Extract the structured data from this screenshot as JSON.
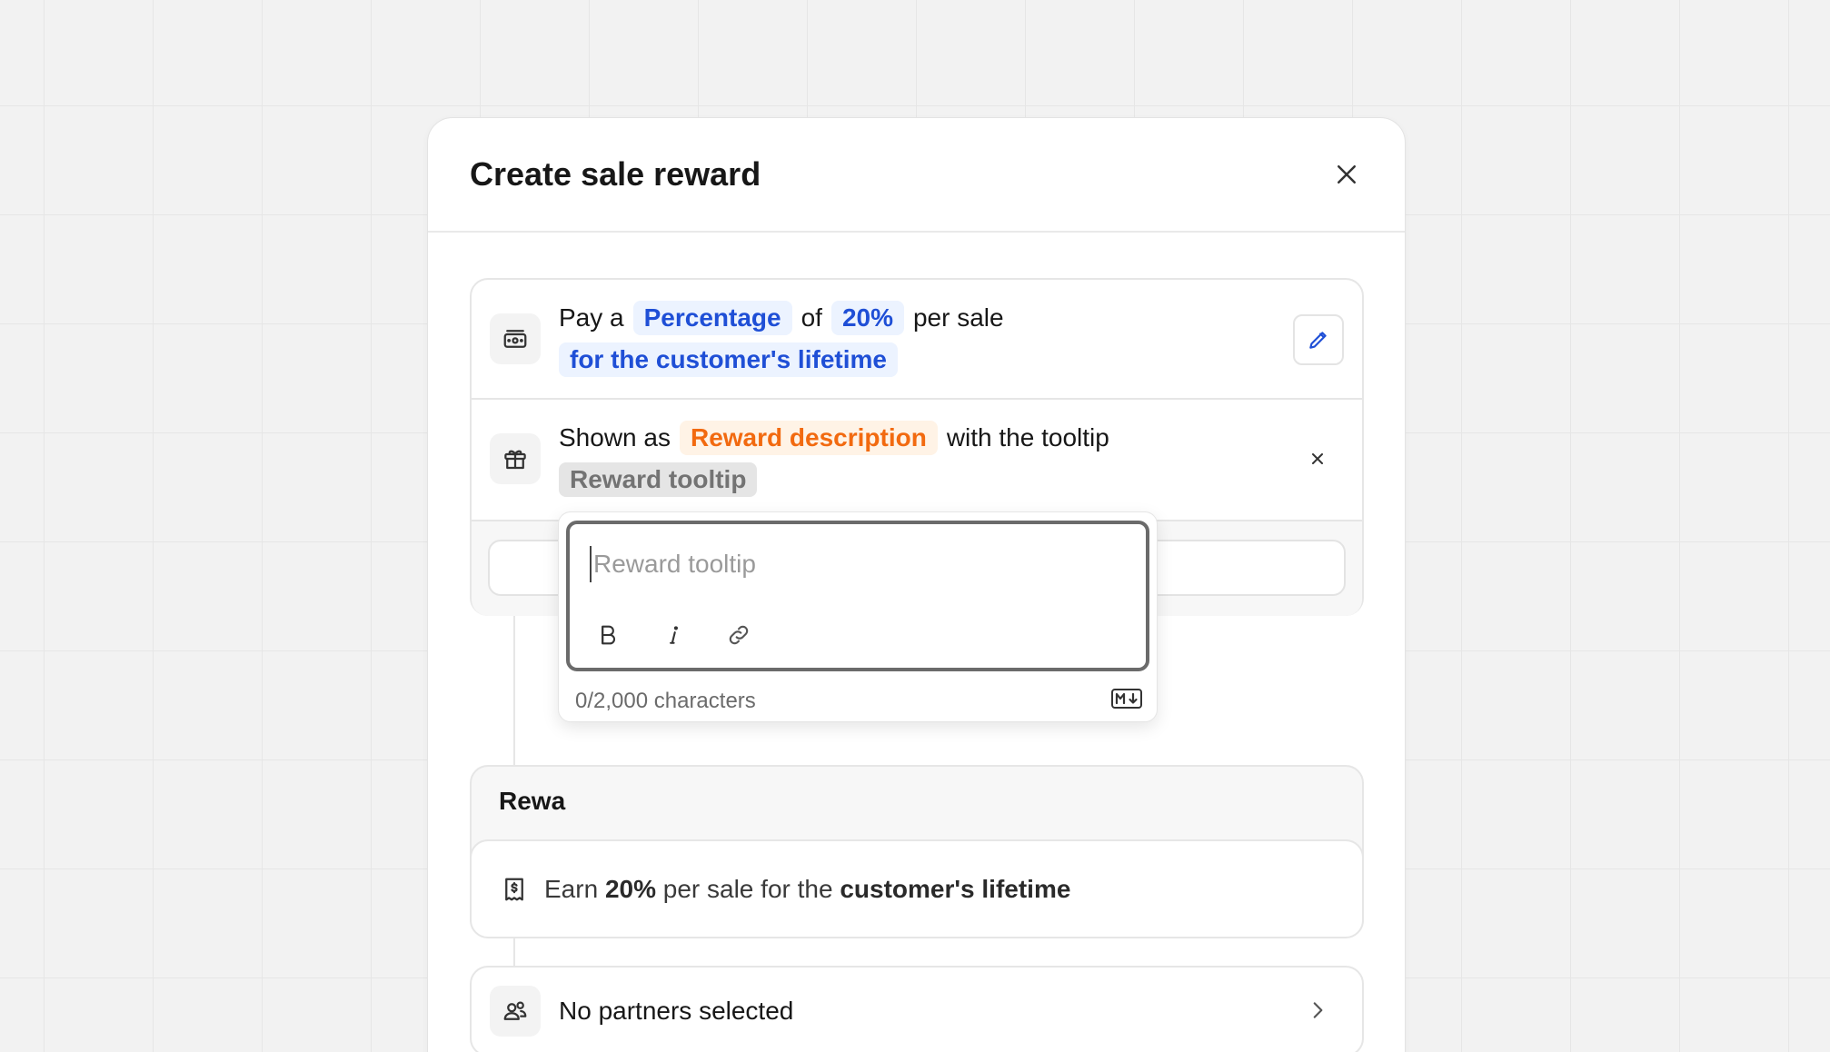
{
  "modal": {
    "title": "Create sale reward"
  },
  "payout": {
    "prefix": "Pay a",
    "type_chip": "Percentage",
    "of_word": "of",
    "amount_chip": "20%",
    "per_word": "per sale",
    "duration_chip": "for the customer's lifetime"
  },
  "display": {
    "shown_as": "Shown as",
    "description_chip": "Reward description",
    "with_tooltip": "with the tooltip",
    "tooltip_chip": "Reward tooltip"
  },
  "tooltip_editor": {
    "placeholder": "Reward tooltip",
    "value": "",
    "char_count": "0/2,000 characters",
    "markdown_badge": "M↓"
  },
  "preview": {
    "label": "Rewa",
    "text_earn": "Earn",
    "text_amount": "20%",
    "text_middle": "per sale for the",
    "text_duration": "customer's lifetime"
  },
  "partners": {
    "label": "No partners selected"
  },
  "colors": {
    "chip_blue_text": "#1f4fd6",
    "chip_blue_bg": "#ecf3ff",
    "chip_orange_text": "#f26a10",
    "chip_orange_bg": "#fff3e6",
    "chip_gray_text": "#737373",
    "chip_gray_bg": "#e5e5e5"
  },
  "icons": {
    "close": "close-icon",
    "money": "money-icon",
    "edit": "pencil-icon",
    "gift": "gift-icon",
    "remove": "x-icon",
    "bold": "bold-icon",
    "italic": "italic-icon",
    "link": "link-icon",
    "markdown": "markdown-icon",
    "receipt": "receipt-dollar-icon",
    "users": "users-icon",
    "chevron": "chevron-right-icon"
  }
}
